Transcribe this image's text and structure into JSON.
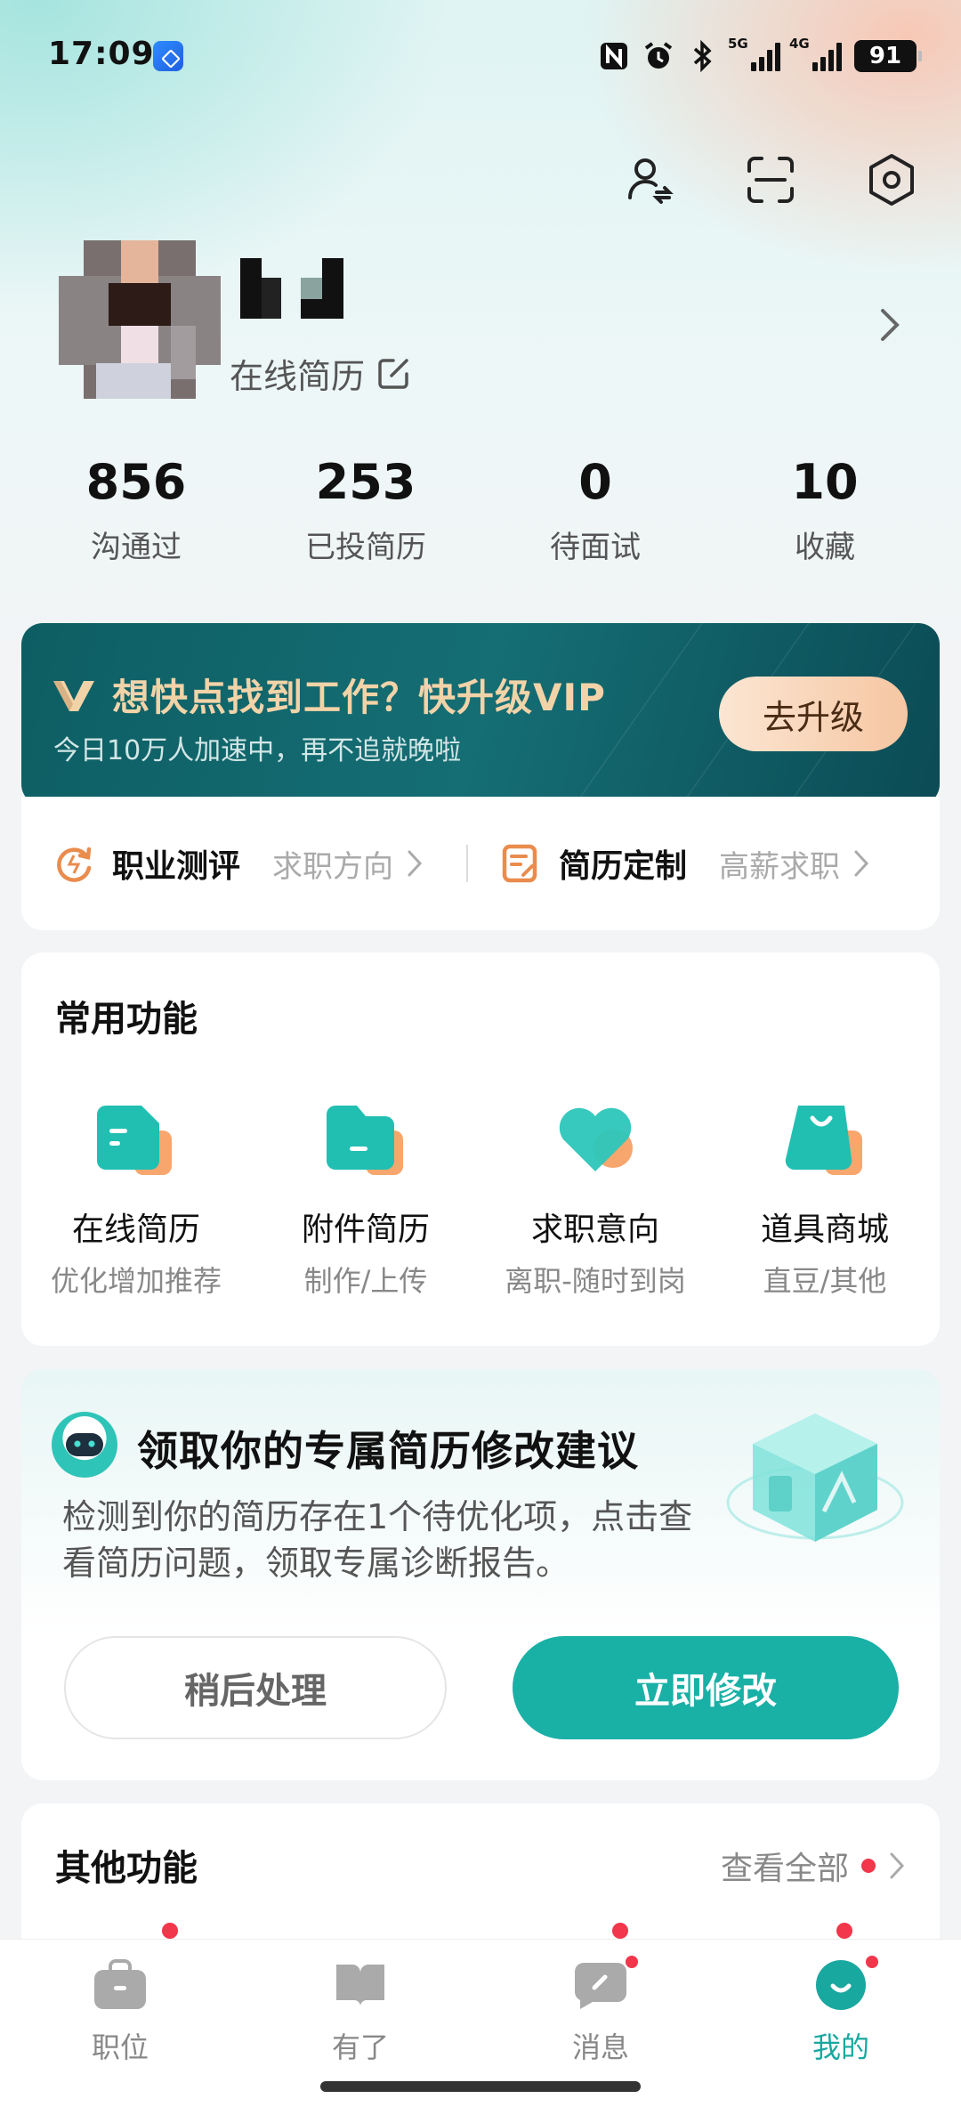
{
  "status_bar": {
    "time": "17:09",
    "signal_5g": "5G",
    "signal_4g": "4G",
    "battery": "91"
  },
  "top_actions": {
    "icons": [
      "switch-identity-icon",
      "scan-icon",
      "settings-icon"
    ]
  },
  "profile": {
    "resume_label": "在线简历"
  },
  "stats": [
    {
      "value": "856",
      "label": "沟通过"
    },
    {
      "value": "253",
      "label": "已投简历"
    },
    {
      "value": "0",
      "label": "待面试"
    },
    {
      "value": "10",
      "label": "收藏"
    }
  ],
  "vip": {
    "title": "想快点找到工作？快升级VIP",
    "subtitle": "今日10万人加速中，再不追就晚啦",
    "button": "去升级",
    "accent": "#f2d3a8"
  },
  "quick": [
    {
      "title": "职业测评",
      "desc": "求职方向"
    },
    {
      "title": "简历定制",
      "desc": "高薪求职"
    }
  ],
  "common": {
    "title": "常用功能",
    "items": [
      {
        "title": "在线简历",
        "sub": "优化增加推荐"
      },
      {
        "title": "附件简历",
        "sub": "制作/上传"
      },
      {
        "title": "求职意向",
        "sub": "离职-随时到岗"
      },
      {
        "title": "道具商城",
        "sub": "直豆/其他"
      }
    ]
  },
  "advice": {
    "title": "领取你的专属简历修改建议",
    "text": "检测到你的简历存在1个待优化项，点击查看简历问题，领取专属诊断报告。",
    "later": "稍后处理",
    "now": "立即修改"
  },
  "others": {
    "title": "其他功能",
    "view_all": "查看全部"
  },
  "tabs": [
    {
      "label": "职位"
    },
    {
      "label": "有了"
    },
    {
      "label": "消息"
    },
    {
      "label": "我的"
    }
  ],
  "colors": {
    "brand": "#19b0a6",
    "badge": "#f2364b"
  }
}
